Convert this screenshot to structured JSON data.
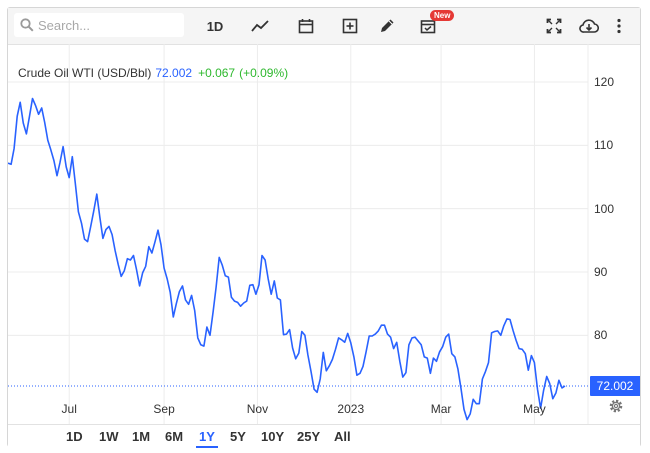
{
  "toolbar": {
    "search_placeholder": "Search...",
    "interval_label": "1D",
    "new_badge": "New",
    "icons": [
      "search-icon",
      "line-chart-icon",
      "calendar-icon",
      "add-box-icon",
      "pencil-icon",
      "calendar-check-icon",
      "fullscreen-icon",
      "cloud-download-icon",
      "more-vertical-icon"
    ]
  },
  "legend": {
    "name": "Crude Oil WTI (USD/Bbl)",
    "price": "72.002",
    "change": "+0.067",
    "change_pct": "(+0.09%)"
  },
  "price_tag": "72.002",
  "colors": {
    "line": "#2962ff",
    "up": "#2eb82e",
    "grid": "#ececec"
  },
  "ranges": {
    "items": [
      "1D",
      "1W",
      "1M",
      "6M",
      "1Y",
      "5Y",
      "10Y",
      "25Y",
      "All"
    ],
    "active": "1Y"
  },
  "chart_data": {
    "type": "line",
    "title": "Crude Oil WTI (USD/Bbl)",
    "xlabel": "",
    "ylabel": "",
    "ylim": [
      66,
      126
    ],
    "y_ticks": [
      "120",
      "110",
      "100",
      "90",
      "80"
    ],
    "x_ticks": [
      "Jul",
      "Sep",
      "Nov",
      "2023",
      "Mar",
      "May"
    ],
    "x_tick_positions": [
      "2022-07-01",
      "2022-09-01",
      "2022-11-01",
      "2023-01-01",
      "2023-03-01",
      "2023-05-01"
    ],
    "xlim": [
      "2022-05-22",
      "2023-06-05"
    ],
    "grid": true,
    "series": [
      {
        "values": [
          [
            "2022-05-22",
            107.2
          ],
          [
            "2022-05-24",
            107.0
          ],
          [
            "2022-05-26",
            109.5
          ],
          [
            "2022-05-28",
            114.6
          ],
          [
            "2022-05-30",
            116.8
          ],
          [
            "2022-06-01",
            113.5
          ],
          [
            "2022-06-03",
            111.8
          ],
          [
            "2022-06-05",
            114.5
          ],
          [
            "2022-06-07",
            117.4
          ],
          [
            "2022-06-09",
            116.3
          ],
          [
            "2022-06-11",
            114.9
          ],
          [
            "2022-06-13",
            115.9
          ],
          [
            "2022-06-15",
            113.6
          ],
          [
            "2022-06-17",
            110.8
          ],
          [
            "2022-06-19",
            109.3
          ],
          [
            "2022-06-21",
            107.6
          ],
          [
            "2022-06-23",
            105.2
          ],
          [
            "2022-06-25",
            107.3
          ],
          [
            "2022-06-27",
            109.8
          ],
          [
            "2022-06-29",
            106.6
          ],
          [
            "2022-07-01",
            104.9
          ],
          [
            "2022-07-03",
            108.2
          ],
          [
            "2022-07-05",
            104.0
          ],
          [
            "2022-07-07",
            99.5
          ],
          [
            "2022-07-09",
            97.7
          ],
          [
            "2022-07-11",
            95.2
          ],
          [
            "2022-07-13",
            94.8
          ],
          [
            "2022-07-15",
            97.1
          ],
          [
            "2022-07-17",
            99.6
          ],
          [
            "2022-07-19",
            102.3
          ],
          [
            "2022-07-21",
            98.7
          ],
          [
            "2022-07-23",
            95.3
          ],
          [
            "2022-07-25",
            96.7
          ],
          [
            "2022-07-27",
            97.2
          ],
          [
            "2022-07-29",
            95.9
          ],
          [
            "2022-07-31",
            93.4
          ],
          [
            "2022-08-02",
            91.2
          ],
          [
            "2022-08-04",
            89.3
          ],
          [
            "2022-08-06",
            90.2
          ],
          [
            "2022-08-08",
            92.1
          ],
          [
            "2022-08-10",
            91.9
          ],
          [
            "2022-08-12",
            92.6
          ],
          [
            "2022-08-14",
            90.4
          ],
          [
            "2022-08-16",
            87.8
          ],
          [
            "2022-08-18",
            89.9
          ],
          [
            "2022-08-20",
            90.9
          ],
          [
            "2022-08-22",
            94.0
          ],
          [
            "2022-08-24",
            93.0
          ],
          [
            "2022-08-26",
            94.7
          ],
          [
            "2022-08-28",
            96.6
          ],
          [
            "2022-08-30",
            94.3
          ],
          [
            "2022-09-01",
            90.6
          ],
          [
            "2022-09-03",
            88.9
          ],
          [
            "2022-09-05",
            86.8
          ],
          [
            "2022-09-07",
            82.9
          ],
          [
            "2022-09-09",
            85.0
          ],
          [
            "2022-09-11",
            86.9
          ],
          [
            "2022-09-13",
            87.8
          ],
          [
            "2022-09-15",
            85.6
          ],
          [
            "2022-09-17",
            84.9
          ],
          [
            "2022-09-19",
            86.3
          ],
          [
            "2022-09-21",
            83.9
          ],
          [
            "2022-09-23",
            79.6
          ],
          [
            "2022-09-25",
            78.5
          ],
          [
            "2022-09-27",
            78.3
          ],
          [
            "2022-09-29",
            81.3
          ],
          [
            "2022-10-01",
            80.0
          ],
          [
            "2022-10-03",
            83.7
          ],
          [
            "2022-10-05",
            87.6
          ],
          [
            "2022-10-07",
            92.3
          ],
          [
            "2022-10-09",
            91.1
          ],
          [
            "2022-10-11",
            89.4
          ],
          [
            "2022-10-13",
            89.2
          ],
          [
            "2022-10-15",
            86.0
          ],
          [
            "2022-10-17",
            85.4
          ],
          [
            "2022-10-19",
            85.2
          ],
          [
            "2022-10-21",
            84.6
          ],
          [
            "2022-10-23",
            85.1
          ],
          [
            "2022-10-25",
            85.4
          ],
          [
            "2022-10-27",
            87.9
          ],
          [
            "2022-10-29",
            88.0
          ],
          [
            "2022-10-31",
            86.5
          ],
          [
            "2022-11-02",
            88.0
          ],
          [
            "2022-11-04",
            92.6
          ],
          [
            "2022-11-06",
            91.9
          ],
          [
            "2022-11-08",
            88.9
          ],
          [
            "2022-11-10",
            86.5
          ],
          [
            "2022-11-12",
            88.6
          ],
          [
            "2022-11-14",
            85.9
          ],
          [
            "2022-11-16",
            85.6
          ],
          [
            "2022-11-18",
            80.1
          ],
          [
            "2022-11-20",
            80.2
          ],
          [
            "2022-11-22",
            80.9
          ],
          [
            "2022-11-24",
            78.0
          ],
          [
            "2022-11-26",
            76.3
          ],
          [
            "2022-11-28",
            77.2
          ],
          [
            "2022-11-30",
            80.6
          ],
          [
            "2022-12-02",
            80.0
          ],
          [
            "2022-12-04",
            76.9
          ],
          [
            "2022-12-06",
            74.3
          ],
          [
            "2022-12-08",
            71.5
          ],
          [
            "2022-12-10",
            71.0
          ],
          [
            "2022-12-12",
            73.1
          ],
          [
            "2022-12-14",
            77.3
          ],
          [
            "2022-12-16",
            74.4
          ],
          [
            "2022-12-18",
            75.2
          ],
          [
            "2022-12-20",
            76.2
          ],
          [
            "2022-12-22",
            77.8
          ],
          [
            "2022-12-24",
            79.6
          ],
          [
            "2022-12-26",
            79.3
          ],
          [
            "2022-12-28",
            78.9
          ],
          [
            "2022-12-30",
            80.3
          ],
          [
            "2023-01-01",
            78.8
          ],
          [
            "2023-01-03",
            76.6
          ],
          [
            "2023-01-05",
            73.7
          ],
          [
            "2023-01-07",
            74.0
          ],
          [
            "2023-01-09",
            75.1
          ],
          [
            "2023-01-11",
            77.4
          ],
          [
            "2023-01-13",
            79.9
          ],
          [
            "2023-01-15",
            79.9
          ],
          [
            "2023-01-17",
            80.2
          ],
          [
            "2023-01-19",
            80.7
          ],
          [
            "2023-01-21",
            81.6
          ],
          [
            "2023-01-23",
            81.6
          ],
          [
            "2023-01-25",
            80.2
          ],
          [
            "2023-01-27",
            79.7
          ],
          [
            "2023-01-29",
            77.9
          ],
          [
            "2023-01-31",
            78.9
          ],
          [
            "2023-02-02",
            75.9
          ],
          [
            "2023-02-04",
            73.4
          ],
          [
            "2023-02-06",
            74.1
          ],
          [
            "2023-02-08",
            78.5
          ],
          [
            "2023-02-10",
            79.6
          ],
          [
            "2023-02-12",
            79.7
          ],
          [
            "2023-02-14",
            79.1
          ],
          [
            "2023-02-16",
            78.5
          ],
          [
            "2023-02-18",
            76.6
          ],
          [
            "2023-02-20",
            76.4
          ],
          [
            "2023-02-22",
            74.0
          ],
          [
            "2023-02-24",
            76.4
          ],
          [
            "2023-02-26",
            75.9
          ],
          [
            "2023-02-28",
            77.4
          ],
          [
            "2023-03-02",
            78.2
          ],
          [
            "2023-03-04",
            79.7
          ],
          [
            "2023-03-06",
            80.2
          ],
          [
            "2023-03-08",
            77.1
          ],
          [
            "2023-03-10",
            76.6
          ],
          [
            "2023-03-12",
            74.7
          ],
          [
            "2023-03-14",
            71.6
          ],
          [
            "2023-03-16",
            68.3
          ],
          [
            "2023-03-18",
            66.7
          ],
          [
            "2023-03-20",
            67.6
          ],
          [
            "2023-03-22",
            69.9
          ],
          [
            "2023-03-24",
            69.2
          ],
          [
            "2023-03-26",
            69.2
          ],
          [
            "2023-03-28",
            73.1
          ],
          [
            "2023-03-30",
            74.3
          ],
          [
            "2023-04-01",
            75.7
          ],
          [
            "2023-04-03",
            80.4
          ],
          [
            "2023-04-05",
            80.6
          ],
          [
            "2023-04-07",
            80.7
          ],
          [
            "2023-04-09",
            80.0
          ],
          [
            "2023-04-11",
            81.5
          ],
          [
            "2023-04-13",
            82.6
          ],
          [
            "2023-04-15",
            82.5
          ],
          [
            "2023-04-17",
            80.8
          ],
          [
            "2023-04-19",
            79.2
          ],
          [
            "2023-04-21",
            77.9
          ],
          [
            "2023-04-23",
            77.8
          ],
          [
            "2023-04-25",
            77.1
          ],
          [
            "2023-04-27",
            74.5
          ],
          [
            "2023-04-29",
            76.8
          ],
          [
            "2023-05-01",
            75.7
          ],
          [
            "2023-05-03",
            71.5
          ],
          [
            "2023-05-05",
            68.5
          ],
          [
            "2023-05-07",
            71.3
          ],
          [
            "2023-05-09",
            73.5
          ],
          [
            "2023-05-11",
            72.4
          ],
          [
            "2023-05-13",
            70.0
          ],
          [
            "2023-05-15",
            70.9
          ],
          [
            "2023-05-17",
            72.9
          ],
          [
            "2023-05-19",
            71.7
          ],
          [
            "2023-05-21",
            72.0
          ]
        ]
      }
    ],
    "last_value": 72.002
  }
}
